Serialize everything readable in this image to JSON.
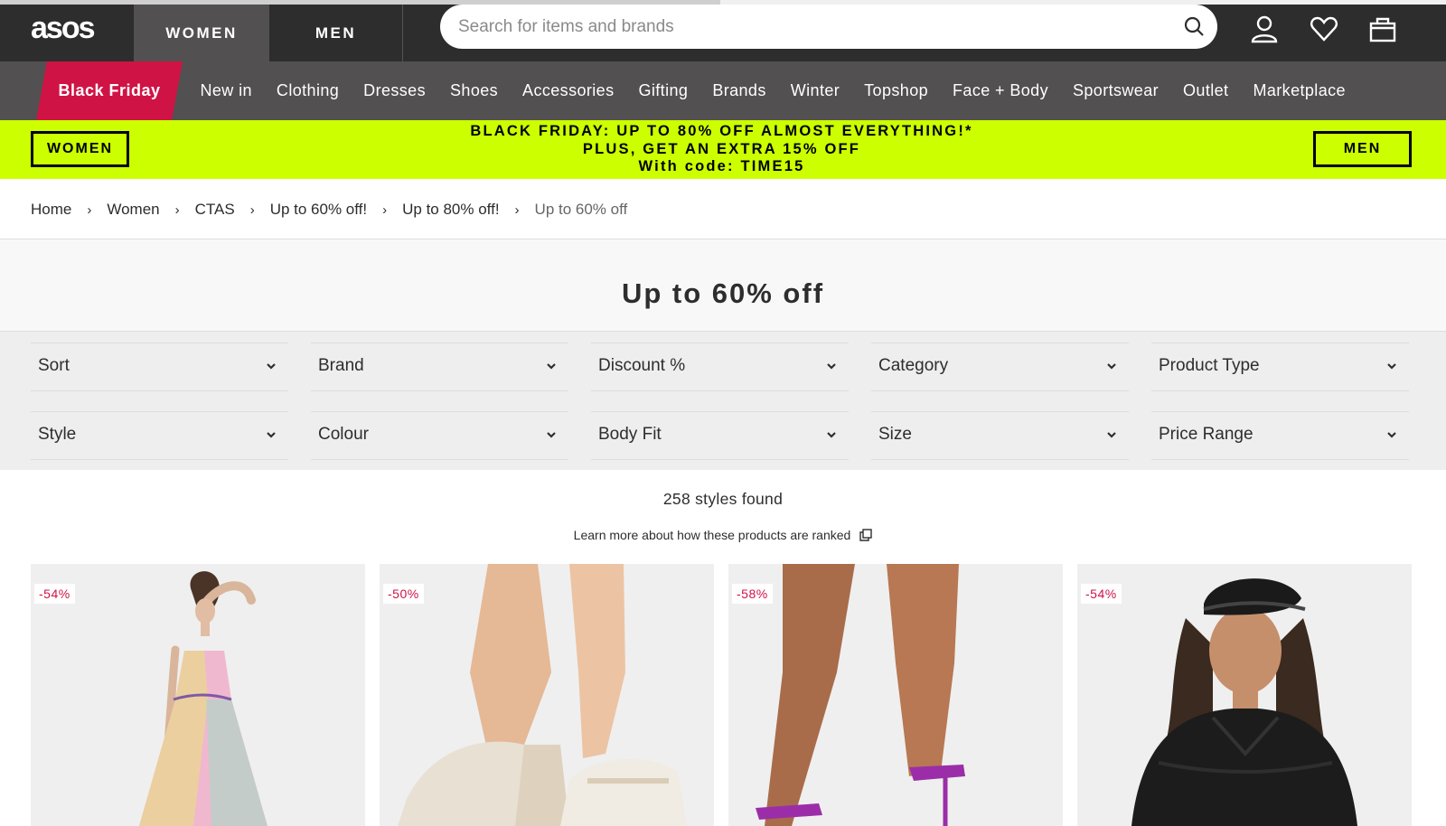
{
  "header": {
    "logo": "asos",
    "tabs": [
      "WOMEN",
      "MEN"
    ],
    "search_placeholder": "Search for items and brands",
    "icons": [
      "search-icon",
      "account-icon",
      "heart-icon",
      "bag-icon"
    ]
  },
  "nav": {
    "highlight": "Black Friday",
    "items": [
      "New in",
      "Clothing",
      "Dresses",
      "Shoes",
      "Accessories",
      "Gifting",
      "Brands",
      "Winter",
      "Topshop",
      "Face + Body",
      "Sportswear",
      "Outlet",
      "Marketplace"
    ]
  },
  "promo": {
    "left_button": "WOMEN",
    "right_button": "MEN",
    "line1": "BLACK FRIDAY: UP TO 80% OFF ALMOST EVERYTHING!*",
    "line2": "PLUS, GET AN EXTRA 15% OFF",
    "line3": "With code: TIME15",
    "color": "#ccff00"
  },
  "breadcrumb": [
    "Home",
    "Women",
    "CTAS",
    "Up to 60% off!",
    "Up to 80% off!",
    "Up to 60% off"
  ],
  "page_title": "Up to 60% off",
  "filters": {
    "row1": [
      "Sort",
      "Brand",
      "Discount %",
      "Category",
      "Product Type"
    ],
    "row2": [
      "Style",
      "Colour",
      "Body Fit",
      "Size",
      "Price Range"
    ]
  },
  "results": {
    "count": "258 styles found",
    "ranked_link": "Learn more about how these products are ranked"
  },
  "products": [
    {
      "discount": "-54%"
    },
    {
      "discount": "-50%"
    },
    {
      "discount": "-58%"
    },
    {
      "discount": "-54%"
    }
  ],
  "colors": {
    "header_bg": "#2d2d2d",
    "nav_bg": "#525050",
    "black_friday": "#d01345",
    "sale_text": "#d01345"
  }
}
